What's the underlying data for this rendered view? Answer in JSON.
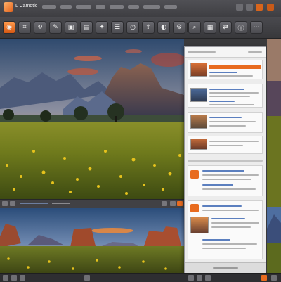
{
  "window": {
    "title": "L Camotic"
  },
  "toolbar": {
    "tools": [
      {
        "icon": "camera-icon",
        "glyph": "◉"
      },
      {
        "icon": "crop-icon",
        "glyph": "⌗"
      },
      {
        "icon": "rotate-icon",
        "glyph": "↻"
      },
      {
        "icon": "brush-icon",
        "glyph": "✎"
      },
      {
        "icon": "image-icon",
        "glyph": "▣"
      },
      {
        "icon": "folder-icon",
        "glyph": "▤"
      },
      {
        "icon": "star-icon",
        "glyph": "✦"
      },
      {
        "icon": "layers-icon",
        "glyph": "☰"
      },
      {
        "icon": "clock-icon",
        "glyph": "◷"
      },
      {
        "icon": "export-icon",
        "glyph": "⇪"
      },
      {
        "icon": "color-icon",
        "glyph": "◐"
      },
      {
        "icon": "settings-icon",
        "glyph": "⚙"
      },
      {
        "icon": "search-icon",
        "glyph": "⌕"
      },
      {
        "icon": "grid-icon",
        "glyph": "▦"
      },
      {
        "icon": "share-icon",
        "glyph": "⇄"
      },
      {
        "icon": "info-icon",
        "glyph": "ⓘ"
      },
      {
        "icon": "more-icon",
        "glyph": "⋯"
      }
    ]
  },
  "panel": {
    "title": ""
  },
  "colors": {
    "accent": "#e86b1f",
    "chrome_dark": "#3a3a3c",
    "panel_bg": "#ececec",
    "link_blue": "#5b7fbf"
  }
}
